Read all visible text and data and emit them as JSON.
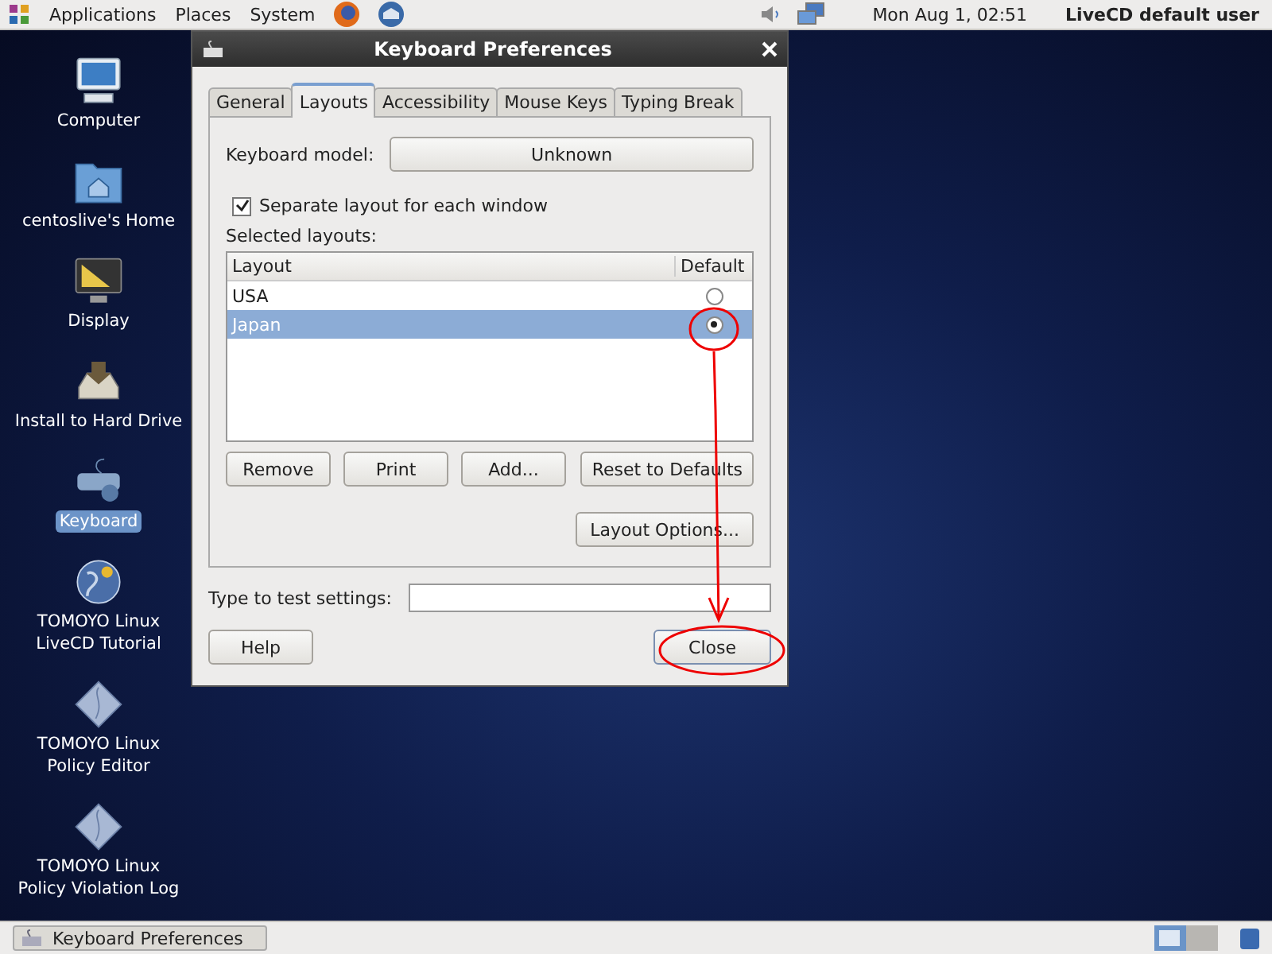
{
  "top_panel": {
    "menus": [
      "Applications",
      "Places",
      "System"
    ],
    "clock": "Mon Aug  1, 02:51",
    "user": "LiveCD default user"
  },
  "desktop_icons": [
    {
      "label": "Computer",
      "kind": "computer",
      "selected": false
    },
    {
      "label": "centoslive's Home",
      "kind": "home",
      "selected": false
    },
    {
      "label": "Display",
      "kind": "display",
      "selected": false
    },
    {
      "label": "Install to Hard Drive",
      "kind": "install",
      "selected": false
    },
    {
      "label": "Keyboard",
      "kind": "keyboard",
      "selected": true
    },
    {
      "label": "TOMOYO Linux\nLiveCD Tutorial",
      "kind": "globe",
      "selected": false
    },
    {
      "label": "TOMOYO Linux\nPolicy Editor",
      "kind": "diamond",
      "selected": false
    },
    {
      "label": "TOMOYO Linux\nPolicy Violation Log",
      "kind": "diamond",
      "selected": false
    }
  ],
  "dialog": {
    "title": "Keyboard Preferences",
    "tabs": [
      {
        "label": "General",
        "selected": false
      },
      {
        "label": "Layouts",
        "selected": true
      },
      {
        "label": "Accessibility",
        "selected": false
      },
      {
        "label": "Mouse Keys",
        "selected": false
      },
      {
        "label": "Typing Break",
        "selected": false
      }
    ],
    "keyboard_model": {
      "label": "Keyboard model:",
      "value": "Unknown"
    },
    "separate_layout": {
      "label": "Separate layout for each window",
      "checked": true
    },
    "selected_layouts_label": "Selected layouts:",
    "table": {
      "columns": [
        "Layout",
        "Default"
      ],
      "rows": [
        {
          "name": "USA",
          "default": false,
          "selected": false
        },
        {
          "name": "Japan",
          "default": true,
          "selected": true
        }
      ]
    },
    "list_buttons": [
      "Remove",
      "Print",
      "Add..."
    ],
    "reset_button": "Reset to Defaults",
    "options_button": "Layout Options...",
    "test_field": {
      "label": "Type to test settings:"
    },
    "help_button": "Help",
    "close_button": "Close"
  },
  "taskbar": {
    "windows": [
      "Keyboard Preferences"
    ]
  }
}
